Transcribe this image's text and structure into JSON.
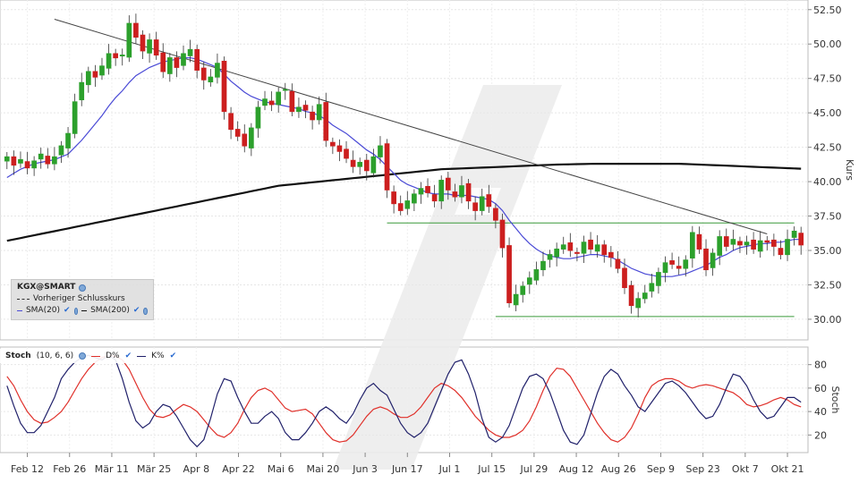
{
  "chart_data": [
    {
      "type": "candlestick",
      "panel": "price",
      "ylabel": "Kurs",
      "ylim": [
        28.5,
        53.2
      ],
      "yticks": [
        "52.50",
        "50.00",
        "47.50",
        "45.00",
        "42.50",
        "40.00",
        "37.50",
        "35.00",
        "32.50",
        "30.00"
      ],
      "ytick_values": [
        52.5,
        50.0,
        47.5,
        45.0,
        42.5,
        40.0,
        37.5,
        35.0,
        32.5,
        30.0
      ],
      "xticks": [
        "Feb 12",
        "Feb 26",
        "Mär 11",
        "Mär 25",
        "Apr 8",
        "Apr 22",
        "Mai 6",
        "Mai 20",
        "Jun 3",
        "Jun 17",
        "Jul 1",
        "Jul 15",
        "Jul 29",
        "Aug 12",
        "Aug 26",
        "Sep 9",
        "Sep 23",
        "Okt 7",
        "Okt 21"
      ],
      "close": [
        41.8,
        41.2,
        41.6,
        41.0,
        41.5,
        42.0,
        41.3,
        41.8,
        42.6,
        43.5,
        45.8,
        47.2,
        48.0,
        47.6,
        48.4,
        49.3,
        49.0,
        49.2,
        51.5,
        50.5,
        49.5,
        50.3,
        49.2,
        48.0,
        49.0,
        48.3,
        49.3,
        49.6,
        48.1,
        47.4,
        47.6,
        48.6,
        45.1,
        43.8,
        43.3,
        42.6,
        43.9,
        45.4,
        46.0,
        45.6,
        46.5,
        46.7,
        45.1,
        45.4,
        45.2,
        44.5,
        45.6,
        43.0,
        42.6,
        42.2,
        41.7,
        41.1,
        41.4,
        40.8,
        41.8,
        42.6,
        39.4,
        38.4,
        37.9,
        38.6,
        39.1,
        39.5,
        39.2,
        38.6,
        40.1,
        39.4,
        38.9,
        39.7,
        38.6,
        37.9,
        38.9,
        38.2,
        37.2,
        35.2,
        31.2,
        31.8,
        32.4,
        33.0,
        33.6,
        34.2,
        34.7,
        35.1,
        35.4,
        35.0,
        34.8,
        35.6,
        35.1,
        35.4,
        34.7,
        34.5,
        33.7,
        32.3,
        31.0,
        31.5,
        31.9,
        32.6,
        33.4,
        34.1,
        34.0,
        33.7,
        34.3,
        36.3,
        35.1,
        33.6,
        34.8,
        36.0,
        35.3,
        35.8,
        35.4,
        35.6,
        35.1,
        35.7,
        35.6,
        35.3,
        34.7,
        35.8,
        36.4,
        35.4
      ],
      "volume_note": "",
      "sma20": [
        40.3,
        40.6,
        40.9,
        41.1,
        41.3,
        41.4,
        41.5,
        41.6,
        41.8,
        42.0,
        42.5,
        43.0,
        43.6,
        44.2,
        44.8,
        45.5,
        46.1,
        46.6,
        47.2,
        47.7,
        48.0,
        48.3,
        48.5,
        48.7,
        48.8,
        48.9,
        49.0,
        49.0,
        48.9,
        48.7,
        48.5,
        48.3,
        47.8,
        47.3,
        46.9,
        46.5,
        46.2,
        46.0,
        45.8,
        45.7,
        45.6,
        45.5,
        45.4,
        45.3,
        45.1,
        45.0,
        44.8,
        44.5,
        44.1,
        43.8,
        43.5,
        43.1,
        42.7,
        42.3,
        42.0,
        41.6,
        41.1,
        40.6,
        40.1,
        39.8,
        39.6,
        39.4,
        39.2,
        39.1,
        39.1,
        39.1,
        39.0,
        39.0,
        39.0,
        38.9,
        38.8,
        38.7,
        38.4,
        37.9,
        37.2,
        36.6,
        36.0,
        35.5,
        35.1,
        34.8,
        34.6,
        34.5,
        34.4,
        34.4,
        34.5,
        34.6,
        34.7,
        34.7,
        34.6,
        34.5,
        34.3,
        34.0,
        33.7,
        33.5,
        33.3,
        33.2,
        33.1,
        33.1,
        33.1,
        33.2,
        33.3,
        33.5,
        33.7,
        33.9,
        34.2,
        34.5,
        34.7,
        35.0,
        35.2,
        35.3,
        35.4,
        35.5,
        35.5,
        35.6,
        35.6,
        35.7,
        35.8,
        35.8
      ],
      "sma200": [
        35.7,
        35.8,
        35.9,
        36.0,
        36.1,
        36.2,
        36.3,
        36.4,
        36.5,
        36.6,
        36.7,
        36.8,
        36.9,
        37.0,
        37.1,
        37.2,
        37.3,
        37.4,
        37.5,
        37.6,
        37.7,
        37.8,
        37.9,
        38.0,
        38.1,
        38.2,
        38.3,
        38.4,
        38.5,
        38.6,
        38.7,
        38.8,
        38.9,
        39.0,
        39.1,
        39.2,
        39.3,
        39.4,
        39.5,
        39.6,
        39.7,
        39.75,
        39.8,
        39.85,
        39.9,
        39.95,
        40.0,
        40.05,
        40.1,
        40.15,
        40.2,
        40.25,
        40.3,
        40.35,
        40.4,
        40.45,
        40.5,
        40.55,
        40.6,
        40.65,
        40.7,
        40.75,
        40.8,
        40.85,
        40.9,
        40.92,
        40.94,
        40.96,
        40.98,
        41.0,
        41.02,
        41.04,
        41.06,
        41.08,
        41.1,
        41.12,
        41.14,
        41.16,
        41.18,
        41.2,
        41.22,
        41.24,
        41.25,
        41.26,
        41.27,
        41.28,
        41.29,
        41.3,
        41.3,
        41.3,
        41.3,
        41.3,
        41.3,
        41.3,
        41.3,
        41.3,
        41.3,
        41.3,
        41.3,
        41.3,
        41.28,
        41.26,
        41.24,
        41.22,
        41.2,
        41.18,
        41.16,
        41.14,
        41.12,
        41.1,
        41.08,
        41.06,
        41.04,
        41.02,
        41.0,
        40.98,
        40.96,
        40.94
      ],
      "trendline": {
        "from": [
          7,
          51.8
        ],
        "to": [
          112,
          36.2
        ]
      },
      "support_lines": [
        {
          "value": 37.0,
          "from_index": 56,
          "to_index": 116
        },
        {
          "value": 30.2,
          "from_index": 72,
          "to_index": 116
        }
      ],
      "colors": {
        "up": "#2ca02c",
        "down": "#cc1f1f",
        "sma20": "#4a4ad6",
        "sma200": "#111111",
        "trend": "#444444",
        "support": "#3a9a3a"
      }
    },
    {
      "type": "line",
      "panel": "stochastic",
      "ylabel": "Stoch",
      "ylim": [
        5,
        95
      ],
      "yticks": [
        "80",
        "60",
        "40",
        "20"
      ],
      "ytick_values": [
        80,
        60,
        40,
        20
      ],
      "series": [
        {
          "name": "D%",
          "color": "#e0302a",
          "values": [
            70,
            62,
            50,
            40,
            33,
            30,
            31,
            35,
            40,
            48,
            58,
            68,
            76,
            82,
            86,
            88,
            87,
            84,
            76,
            64,
            52,
            42,
            36,
            35,
            37,
            42,
            46,
            44,
            40,
            33,
            26,
            20,
            18,
            22,
            30,
            42,
            52,
            58,
            60,
            57,
            50,
            43,
            40,
            41,
            42,
            38,
            30,
            22,
            16,
            14,
            15,
            20,
            28,
            36,
            42,
            44,
            42,
            38,
            35,
            35,
            38,
            44,
            52,
            60,
            64,
            62,
            58,
            52,
            44,
            36,
            30,
            24,
            20,
            18,
            18,
            20,
            24,
            32,
            44,
            58,
            70,
            77,
            76,
            70,
            60,
            50,
            40,
            30,
            22,
            16,
            14,
            18,
            26,
            38,
            52,
            62,
            66,
            68,
            68,
            66,
            62,
            60,
            62,
            63,
            62,
            60,
            58,
            56,
            52,
            46,
            44,
            45,
            47,
            50,
            52,
            50,
            46,
            44
          ]
        },
        {
          "name": "K%",
          "color": "#20206a",
          "values": [
            62,
            45,
            30,
            22,
            22,
            28,
            40,
            52,
            68,
            76,
            82,
            86,
            88,
            86,
            84,
            88,
            84,
            68,
            48,
            32,
            26,
            30,
            40,
            46,
            44,
            36,
            26,
            16,
            10,
            16,
            34,
            55,
            68,
            66,
            52,
            40,
            30,
            30,
            36,
            40,
            34,
            22,
            16,
            16,
            22,
            30,
            40,
            44,
            40,
            34,
            30,
            38,
            50,
            60,
            64,
            58,
            54,
            42,
            30,
            22,
            18,
            22,
            30,
            44,
            58,
            72,
            82,
            84,
            72,
            56,
            34,
            18,
            14,
            18,
            28,
            44,
            60,
            70,
            72,
            68,
            56,
            40,
            24,
            14,
            12,
            20,
            38,
            56,
            70,
            76,
            72,
            62,
            54,
            44,
            40,
            48,
            56,
            64,
            66,
            62,
            56,
            48,
            40,
            34,
            36,
            46,
            60,
            72,
            70,
            62,
            50,
            40,
            34,
            36,
            44,
            52,
            52,
            48
          ]
        }
      ]
    }
  ],
  "legend": {
    "title": "KGX@SMART",
    "prev_close": "Vorheriger Schlusskurs",
    "sma20": "SMA(20)",
    "sma200": "SMA(200)"
  },
  "stoch_legend": {
    "title": "Stoch",
    "params": "(10, 6, 6)",
    "d": "D%",
    "k": "K%"
  }
}
